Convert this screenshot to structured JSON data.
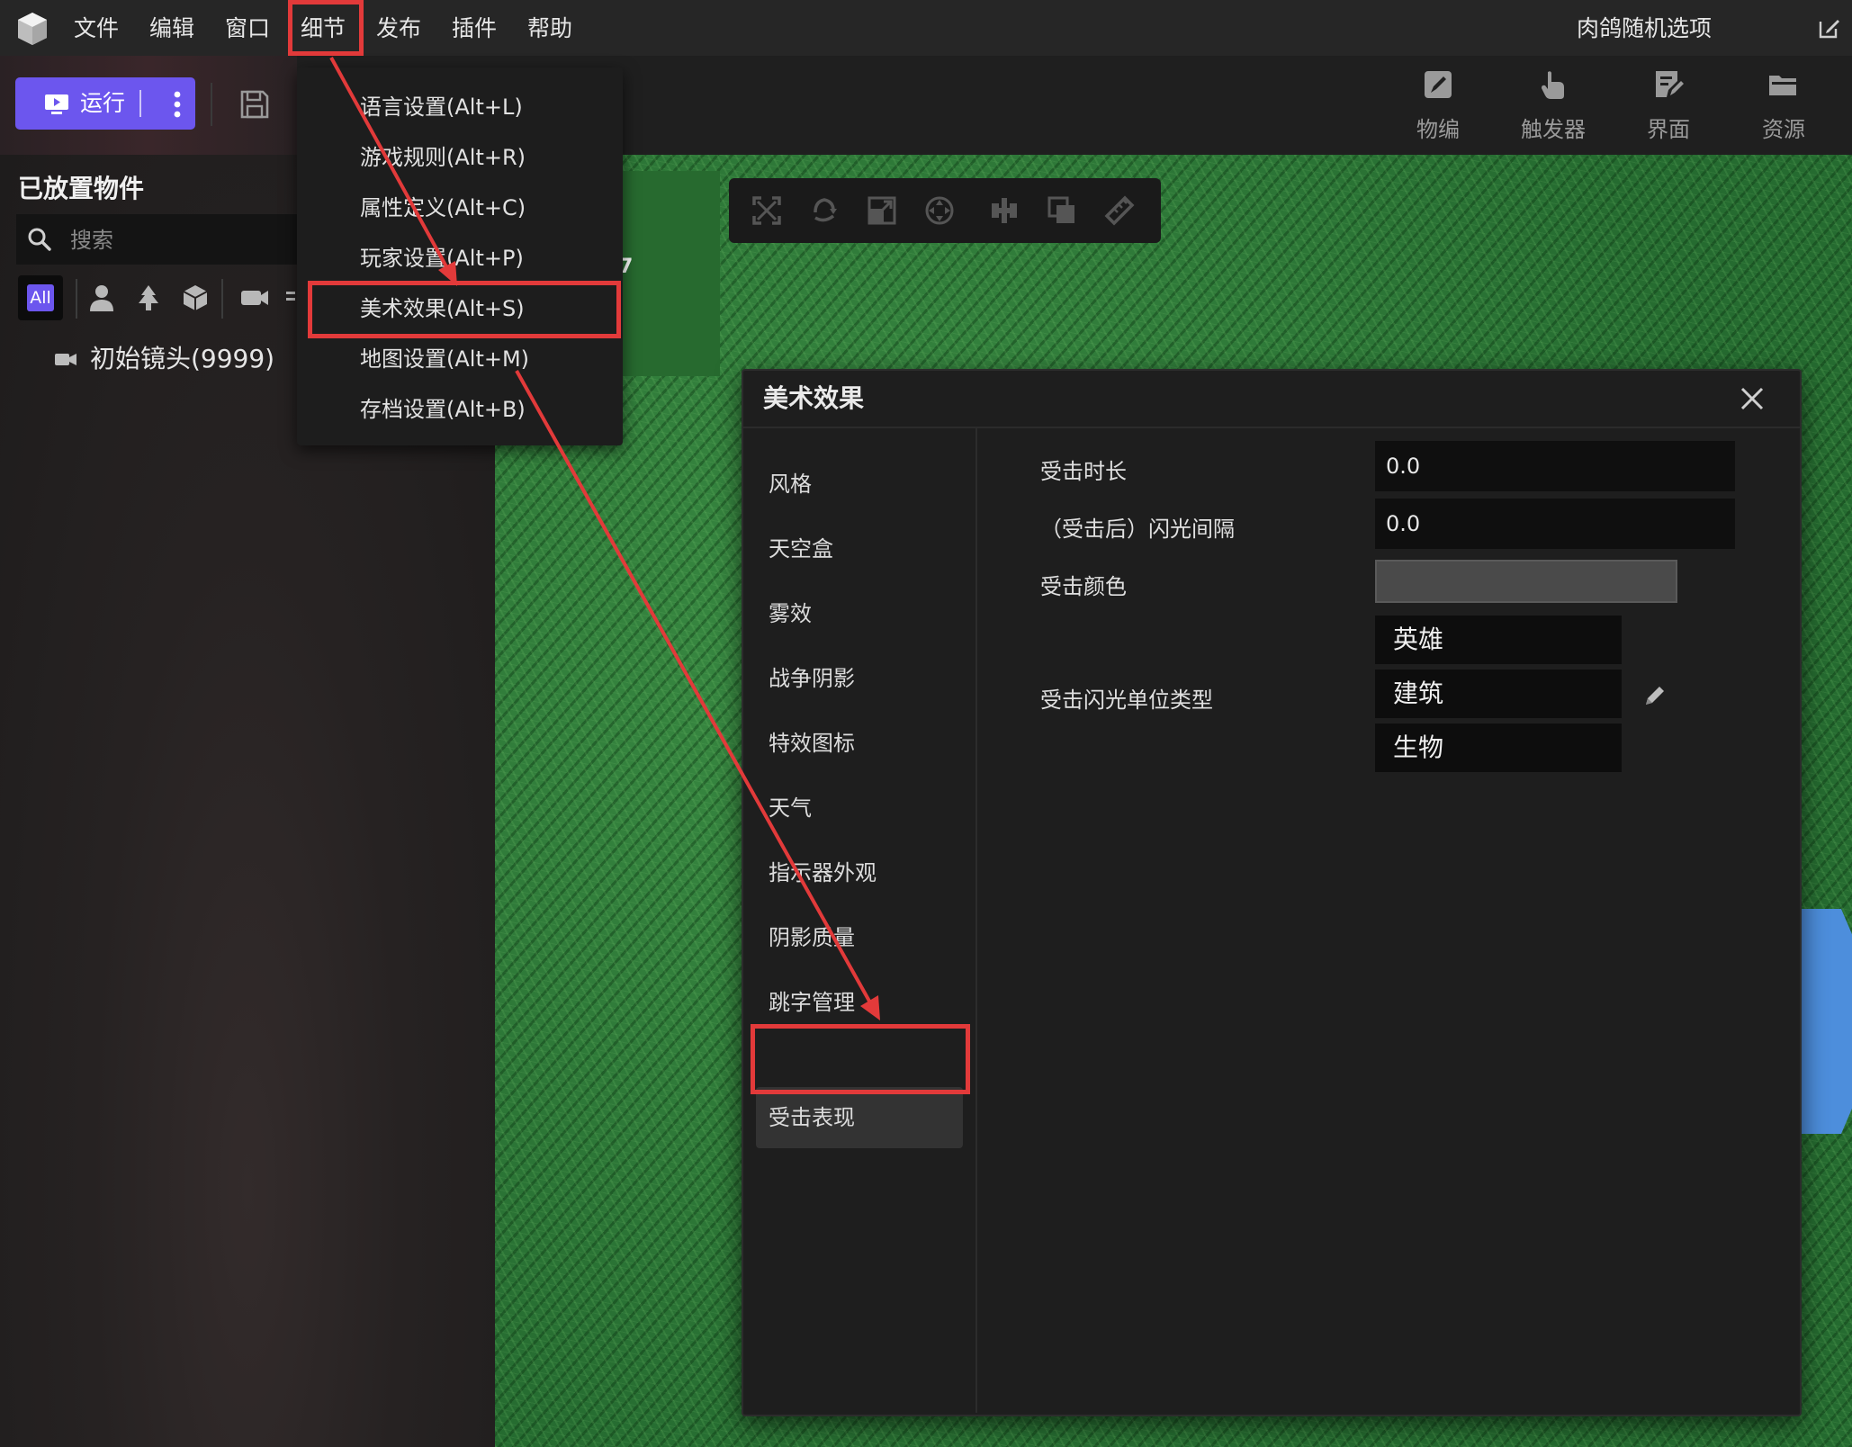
{
  "menubar": {
    "items": [
      "文件",
      "编辑",
      "窗口",
      "细节",
      "发布",
      "插件",
      "帮助"
    ],
    "project_name": "肉鸽随机选项"
  },
  "toolbar": {
    "run_label": "运行",
    "tools": [
      "物编",
      "触发器",
      "界面",
      "资源"
    ]
  },
  "left_panel": {
    "title": "已放置物件",
    "search_placeholder": "搜索",
    "filter_all_label": "All",
    "tree_items": [
      "初始镜头(9999)"
    ]
  },
  "viewport": {
    "overlay_text": "7"
  },
  "detail_menu": {
    "items": [
      "语言设置(Alt+L)",
      "游戏规则(Alt+R)",
      "属性定义(Alt+C)",
      "玩家设置(Alt+P)",
      "美术效果(Alt+S)",
      "地图设置(Alt+M)",
      "存档设置(Alt+B)"
    ],
    "highlighted_index": 4
  },
  "dialog": {
    "title": "美术效果",
    "nav_items": [
      "风格",
      "天空盒",
      "雾效",
      "战争阴影",
      "特效图标",
      "天气",
      "指示器外观",
      "阴影质量",
      "跳字管理",
      "受击表现"
    ],
    "active_nav_index": 9,
    "fields": {
      "hit_duration_label": "受击时长",
      "hit_duration_value": "0.0",
      "flash_interval_label": "（受击后）闪光间隔",
      "flash_interval_value": "0.0",
      "hit_color_label": "受击颜色",
      "hit_color_value": "#4a4a4a",
      "flash_unit_type_label": "受击闪光单位类型",
      "flash_unit_types": [
        "英雄",
        "建筑",
        "生物"
      ]
    }
  },
  "colors": {
    "accent": "#6c56ee",
    "annotation_red": "#e23a3a",
    "grass_green": "#2c7a37",
    "blue_object": "#4d8edc"
  }
}
